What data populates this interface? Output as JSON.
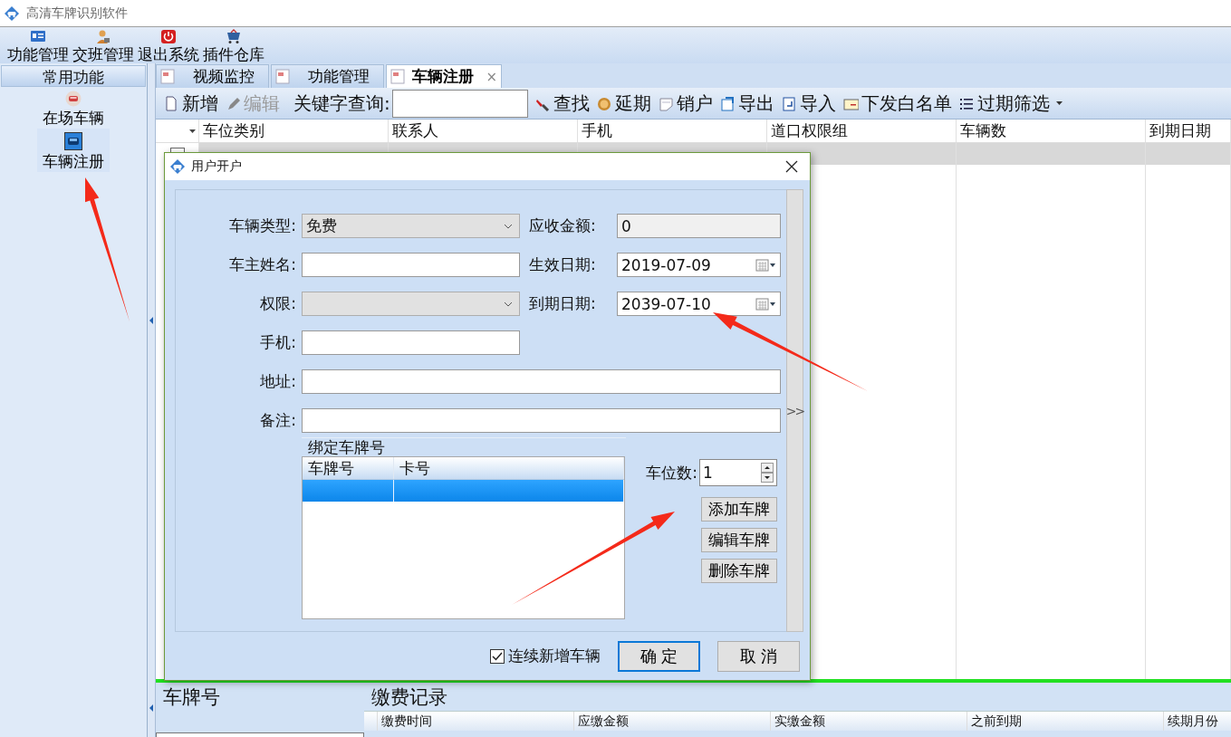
{
  "app": {
    "title": "高清车牌识别软件"
  },
  "menu": [
    {
      "label": "功能管理"
    },
    {
      "label": "交班管理"
    },
    {
      "label": "退出系统"
    },
    {
      "label": "插件仓库"
    }
  ],
  "sidebar": {
    "header": "常用功能",
    "items": [
      {
        "label": "在场车辆",
        "selected": false
      },
      {
        "label": "车辆注册",
        "selected": true
      }
    ]
  },
  "tabs": [
    {
      "label": "视频监控",
      "selected": false,
      "closable": false
    },
    {
      "label": "功能管理",
      "selected": false,
      "closable": false
    },
    {
      "label": "车辆注册",
      "selected": true,
      "closable": true,
      "close": "×"
    }
  ],
  "toolbar": {
    "items": [
      {
        "kind": "button",
        "label": "新增",
        "disabled": false
      },
      {
        "kind": "button",
        "label": "编辑",
        "disabled": true
      },
      {
        "kind": "search",
        "label": "关键字查询:"
      },
      {
        "kind": "button",
        "label": "查找",
        "disabled": false
      },
      {
        "kind": "button",
        "label": "延期",
        "disabled": false
      },
      {
        "kind": "button",
        "label": "销户",
        "disabled": false
      },
      {
        "kind": "button",
        "label": "导出",
        "disabled": false
      },
      {
        "kind": "button",
        "label": "导入",
        "disabled": false
      },
      {
        "kind": "button",
        "label": "下发白名单",
        "disabled": false
      },
      {
        "kind": "dropdown",
        "label": "过期筛选",
        "disabled": false
      }
    ]
  },
  "grid": {
    "columns": [
      "车位类别",
      "联系人",
      "手机",
      "道口权限组",
      "车辆数",
      "到期日期"
    ],
    "rows": [
      {
        "selected": true
      }
    ]
  },
  "dialog": {
    "title": "用户开户",
    "fields": [
      {
        "kind": "select",
        "label": "车辆类型:",
        "value": "免费"
      },
      {
        "kind": "readonly",
        "label": "应收金额:",
        "value": "0"
      },
      {
        "kind": "text",
        "label": "车主姓名:"
      },
      {
        "kind": "date",
        "label": "生效日期:",
        "value": "2019-07-09"
      },
      {
        "kind": "select",
        "label": "权限:"
      },
      {
        "kind": "date",
        "label": "到期日期:",
        "value": "2039-07-10"
      },
      {
        "kind": "text",
        "label": "手机:"
      },
      {
        "kind": "wide_text",
        "label": "地址:"
      },
      {
        "kind": "wide_text",
        "label": "备注:"
      }
    ],
    "expander": ">>",
    "plates": {
      "title": "绑定车牌号",
      "columns": [
        "车牌号",
        "卡号"
      ],
      "rows": [
        {
          "selected": true
        }
      ]
    },
    "spaces": {
      "label": "车位数:",
      "value": "1"
    },
    "plate_buttons": [
      "添加车牌",
      "编辑车牌",
      "删除车牌"
    ],
    "continuous": {
      "label": "连续新增车辆",
      "checked": true
    },
    "buttons": [
      {
        "label": "确 定",
        "default": true
      },
      {
        "label": "取 消",
        "default": false
      }
    ]
  },
  "bottom": {
    "plate_label": "车牌号",
    "payments": {
      "title": "缴费记录",
      "columns": [
        "缴费时间",
        "应缴金额",
        "实缴金额",
        "之前到期",
        "续期月份"
      ]
    }
  }
}
